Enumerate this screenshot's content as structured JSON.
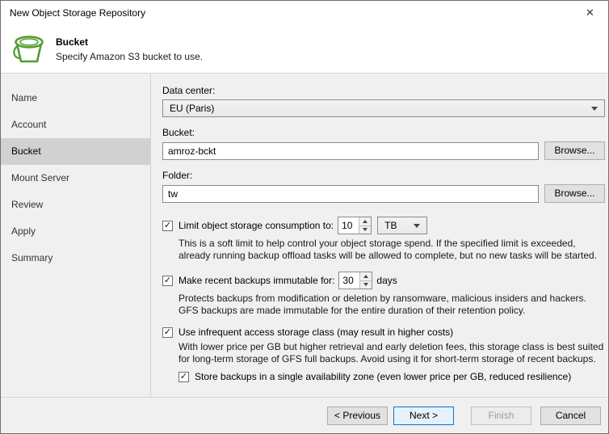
{
  "window": {
    "title": "New Object Storage Repository",
    "close_glyph": "✕"
  },
  "header": {
    "title": "Bucket",
    "subtitle": "Specify Amazon S3 bucket to use."
  },
  "sidebar": {
    "items": [
      {
        "label": "Name"
      },
      {
        "label": "Account"
      },
      {
        "label": "Bucket"
      },
      {
        "label": "Mount Server"
      },
      {
        "label": "Review"
      },
      {
        "label": "Apply"
      },
      {
        "label": "Summary"
      }
    ]
  },
  "form": {
    "datacenter_label": "Data center:",
    "datacenter_value": "EU (Paris)",
    "bucket_label": "Bucket:",
    "bucket_value": "amroz-bckt",
    "folder_label": "Folder:",
    "folder_value": "tw",
    "browse_label": "Browse...",
    "limit": {
      "label": "Limit object storage consumption to:",
      "value": "10",
      "unit": "TB",
      "description": "This is a soft limit to help control your object storage spend. If the specified limit is exceeded, already running backup offload tasks will be allowed to complete, but no new tasks will be started."
    },
    "immutable": {
      "label": "Make recent backups immutable for:",
      "value": "30",
      "unit": "days",
      "description": "Protects backups from modification or deletion by ransomware, malicious insiders and hackers. GFS backups are made immutable for the entire duration of their retention policy."
    },
    "infrequent": {
      "label": "Use infrequent access storage class (may result in higher costs)",
      "description": "With lower price per GB but higher retrieval and early deletion fees, this storage class is best suited for long-term storage of GFS full backups. Avoid using it for short-term storage of recent backups."
    },
    "single_zone": {
      "label": "Store backups in a single availability zone (even lower price per GB, reduced resilience)"
    },
    "check_glyph": "✓"
  },
  "footer": {
    "previous": "< Previous",
    "next": "Next >",
    "finish": "Finish",
    "cancel": "Cancel"
  }
}
